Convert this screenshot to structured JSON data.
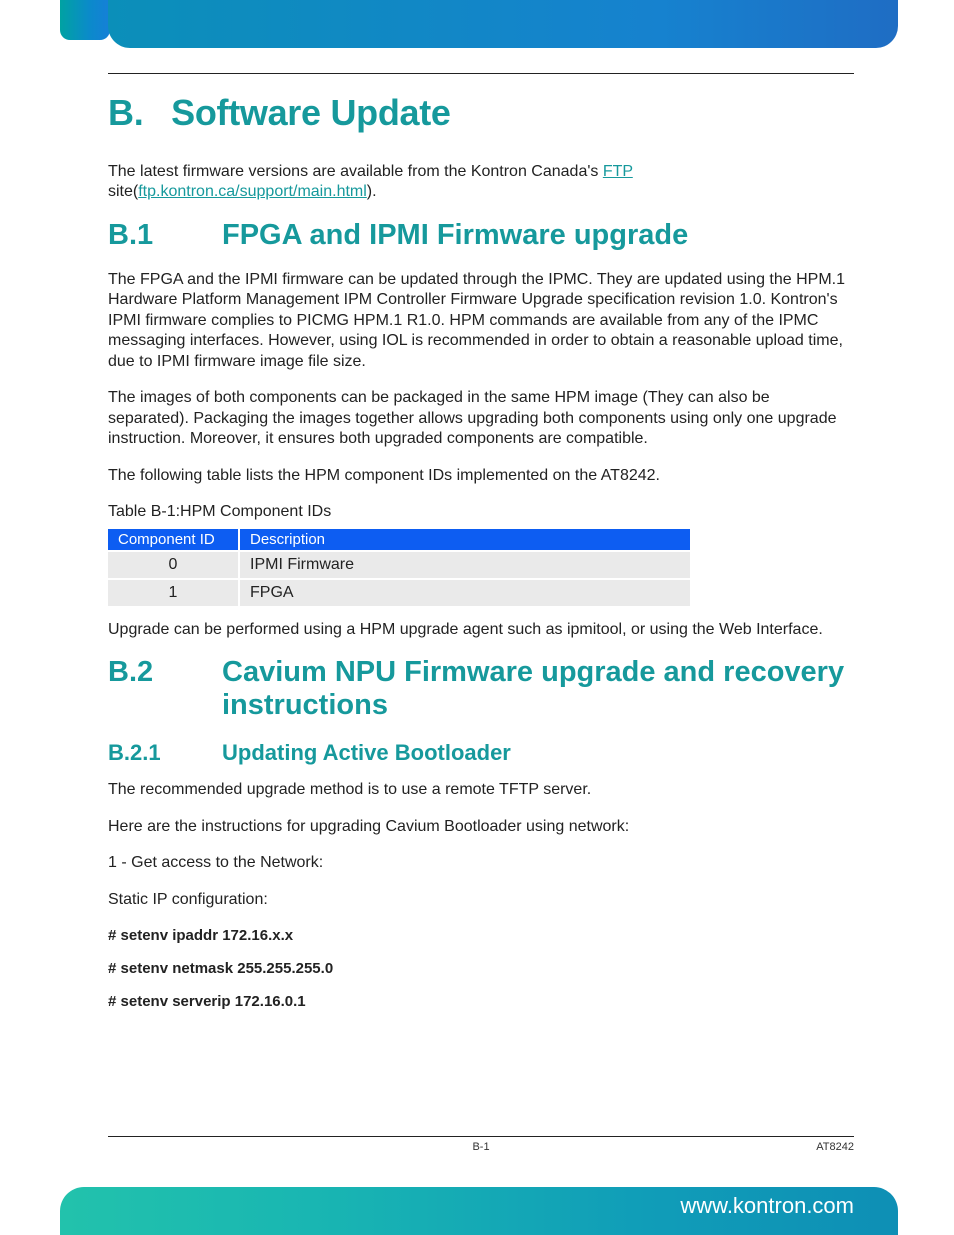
{
  "title": {
    "prefix": "B.",
    "text": "Software Update"
  },
  "intro": {
    "pre": "The latest firmware versions are available from the Kontron Canada's ",
    "link1_text": "FTP",
    "mid": " site(",
    "link2_text": "ftp.kontron.ca/support/main.html",
    "post": ")."
  },
  "s1": {
    "prefix": "B.1",
    "title": "FPGA and IPMI Firmware upgrade",
    "p1": "The FPGA and the IPMI firmware can be updated through the IPMC. They are updated using the HPM.1 Hardware Platform Management IPM Controller Firmware Upgrade specification revision 1.0. Kontron's IPMI firmware complies to PICMG HPM.1 R1.0. HPM commands are available from any of the IPMC messaging interfaces. However, using IOL is recommended in order to obtain a reasonable upload time, due to IPMI firmware image file size.",
    "p2": "The images of both components can be packaged in the same HPM image (They can also be separated). Packaging the images together allows upgrading both components using only one upgrade instruction. Moreover, it ensures both upgraded components are compatible.",
    "p3": "The following table lists the HPM component IDs implemented on the AT8242.",
    "table_caption": "Table B-1:HPM Component IDs",
    "table_headers": {
      "c0": "Component ID",
      "c1": "Description"
    },
    "table_rows": [
      {
        "id": "0",
        "desc": "IPMI Firmware"
      },
      {
        "id": "1",
        "desc": "FPGA"
      }
    ],
    "p4": "Upgrade can be performed using a HPM upgrade agent such as ipmitool, or using the Web Interface."
  },
  "s2": {
    "prefix": "B.2",
    "title": "Cavium NPU Firmware upgrade and recovery instructions",
    "sub1": {
      "prefix": "B.2.1",
      "title": "Updating Active Bootloader"
    },
    "p1": "The recommended upgrade method is to use a remote TFTP server.",
    "p2": "Here are the instructions for upgrading Cavium Bootloader using network:",
    "p3": "1 - Get access to the Network:",
    "p4": "Static IP configuration:",
    "cmd1": "# setenv ipaddr 172.16.x.x",
    "cmd2": "# setenv netmask 255.255.255.0",
    "cmd3": "# setenv serverip 172.16.0.1"
  },
  "footer": {
    "page": "B-1",
    "doc": "AT8242",
    "url": "www.kontron.com"
  }
}
